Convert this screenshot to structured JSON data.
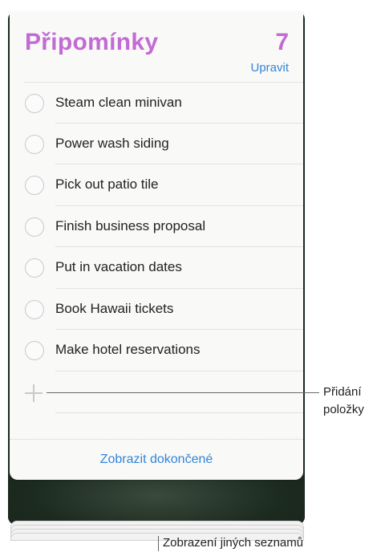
{
  "reminders": {
    "title": "Připomínky",
    "count": "7",
    "edit_label": "Upravit",
    "items": [
      {
        "label": "Steam clean minivan"
      },
      {
        "label": "Power wash siding"
      },
      {
        "label": "Pick out patio tile"
      },
      {
        "label": "Finish business proposal"
      },
      {
        "label": "Put in vacation dates"
      },
      {
        "label": "Book Hawaii tickets"
      },
      {
        "label": "Make hotel reservations"
      }
    ],
    "show_completed_label": "Zobrazit dokončené"
  },
  "callouts": {
    "add_item_line1": "Přidání",
    "add_item_line2": "položky",
    "other_lists": "Zobrazení jiných seznamů"
  },
  "colors": {
    "title": "#c36ad4",
    "link": "#2f86d8"
  }
}
